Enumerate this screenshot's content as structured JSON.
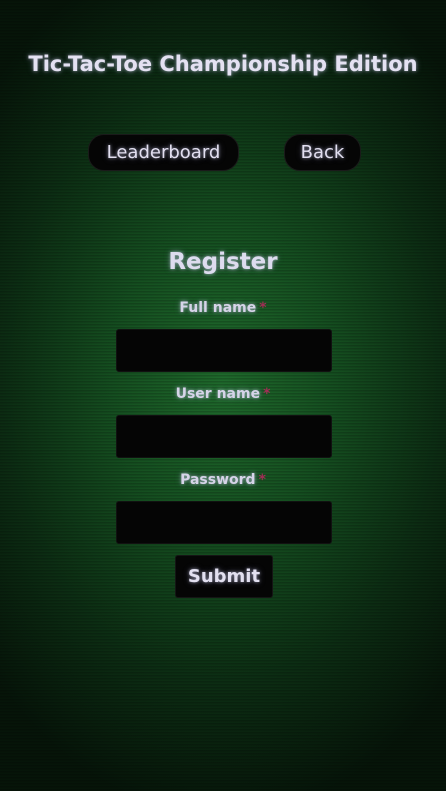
{
  "app": {
    "title": "Tic-Tac-Toe Championship Edition"
  },
  "nav": {
    "leaderboard_label": "Leaderboard",
    "back_label": "Back"
  },
  "form": {
    "heading": "Register",
    "required_marker": "*",
    "fields": {
      "full_name": {
        "label": "Full name",
        "value": ""
      },
      "user_name": {
        "label": "User name",
        "value": ""
      },
      "password": {
        "label": "Password",
        "value": ""
      }
    },
    "submit_label": "Submit"
  },
  "colors": {
    "background_center": "#1f6a2c",
    "background_edge": "#061509",
    "control_background": "#050505",
    "text": "#dcdcf0",
    "required_marker": "#a02e55"
  }
}
